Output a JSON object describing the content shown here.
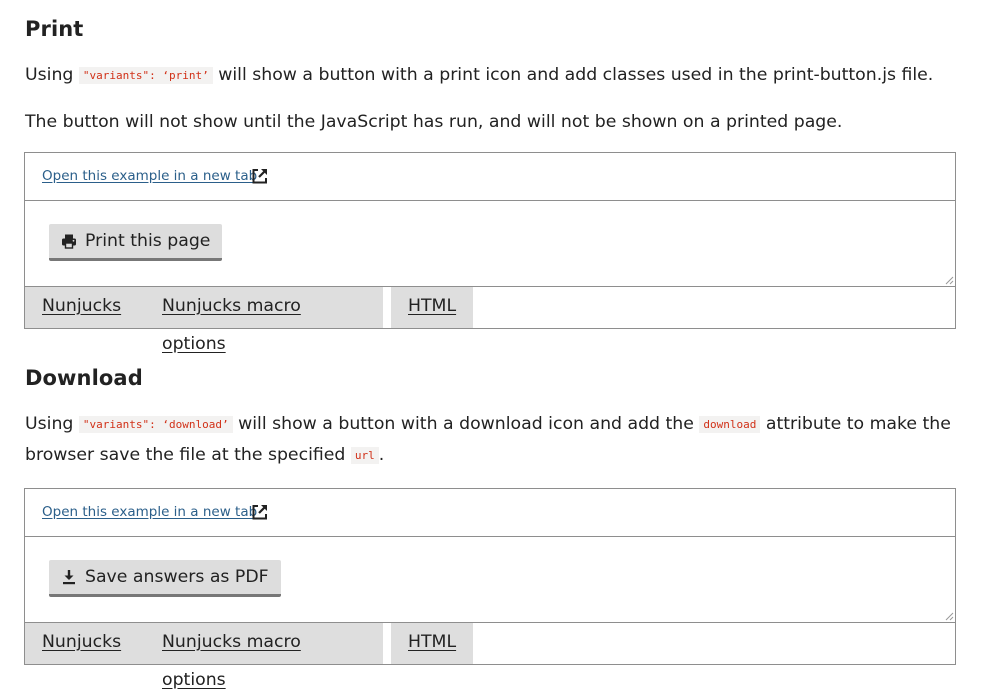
{
  "print_section": {
    "heading": "Print",
    "para1": {
      "before": "Using",
      "code": "\"variants\": ‘print’",
      "after": "will show a button with a print icon and add classes used in the print-button.js file."
    },
    "para2": "The button will not show until the JavaScript has run, and will not be shown on a printed page.",
    "example": {
      "link_text": "Open this example in a new tab",
      "button_label": "Print this page",
      "button_icon": "printer-icon",
      "tabs": [
        "Nunjucks",
        "Nunjucks macro options",
        "HTML"
      ]
    }
  },
  "download_section": {
    "heading": "Download",
    "para1": {
      "before": "Using",
      "code1": "\"variants\": ‘download’",
      "middle": "will show a button with a download icon and add the",
      "code2": "download",
      "after1": "attribute to make the",
      "line2": "browser save the file at the specified",
      "code3": "url",
      "end": "."
    },
    "example": {
      "link_text": "Open this example in a new tab",
      "button_label": "Save answers as PDF",
      "button_icon": "download-icon",
      "tabs": [
        "Nunjucks",
        "Nunjucks macro options",
        "HTML"
      ]
    }
  },
  "colors": {
    "link": "#2b5f8a",
    "code_text": "#d13118",
    "button_bg": "#dddddd",
    "tab_bg": "#dedede"
  }
}
